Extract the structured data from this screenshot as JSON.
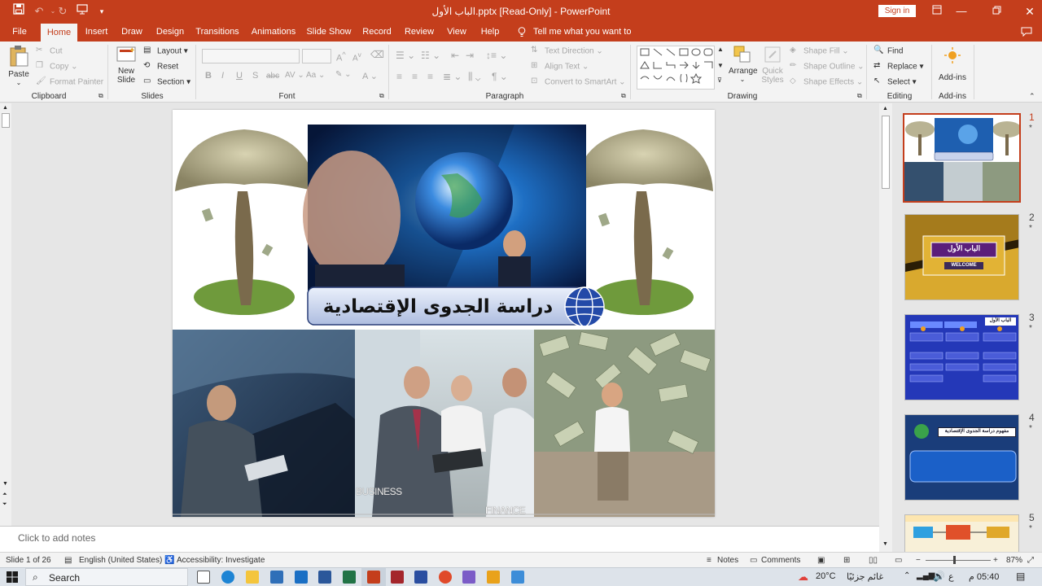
{
  "window": {
    "title": "الباب الأول.pptx [Read-Only]  -  PowerPoint",
    "sign_in": "Sign in"
  },
  "tabs": [
    "File",
    "Home",
    "Insert",
    "Draw",
    "Design",
    "Transitions",
    "Animations",
    "Slide Show",
    "Record",
    "Review",
    "View",
    "Help"
  ],
  "tell_me": "Tell me what you want to do",
  "ribbon": {
    "clipboard": {
      "label": "Clipboard",
      "paste": "Paste",
      "cut": "Cut",
      "copy": "Copy",
      "format_painter": "Format Painter"
    },
    "slides": {
      "label": "Slides",
      "new_slide_1": "New",
      "new_slide_2": "Slide",
      "layout": "Layout",
      "reset": "Reset",
      "section": "Section"
    },
    "font": {
      "label": "Font"
    },
    "paragraph": {
      "label": "Paragraph",
      "text_direction": "Text Direction",
      "align_text": "Align Text",
      "convert_smartart": "Convert to SmartArt"
    },
    "drawing": {
      "label": "Drawing",
      "arrange": "Arrange",
      "quick_styles_1": "Quick",
      "quick_styles_2": "Styles",
      "shape_fill": "Shape Fill",
      "shape_outline": "Shape Outline",
      "shape_effects": "Shape Effects"
    },
    "editing": {
      "label": "Editing",
      "find": "Find",
      "replace": "Replace",
      "select": "Select"
    },
    "addins": {
      "label": "Add-ins",
      "addins": "Add-ins"
    }
  },
  "slide": {
    "banner_text": "دراسة الجدوى الإقتصادية",
    "photo_label_business": "BUSINESS",
    "photo_label_finance": "FINANCE"
  },
  "notes_placeholder": "Click to add notes",
  "thumbnails": [
    {
      "num": "1",
      "star": "*"
    },
    {
      "num": "2",
      "star": "*",
      "text": "الباب الأول",
      "sub": "WELCOME"
    },
    {
      "num": "3",
      "star": "*",
      "text": "الباب الأول"
    },
    {
      "num": "4",
      "star": "*",
      "text": "مفهوم دراسة الجدوى الإقتصادية"
    },
    {
      "num": "5",
      "star": "*"
    }
  ],
  "status": {
    "slide_count": "Slide 1 of 26",
    "language": "English (United States)",
    "accessibility": "Accessibility: Investigate",
    "notes": "Notes",
    "comments": "Comments",
    "zoom": "87%"
  },
  "taskbar": {
    "search": "Search",
    "temperature": "20°C",
    "weather": "غائم جزئيًا",
    "lang": "ع",
    "time": "05:40 م"
  },
  "colors": {
    "accent": "#c43e1c",
    "ribbon_bg": "#f3f3f3",
    "workspace": "#e6e6e6"
  }
}
